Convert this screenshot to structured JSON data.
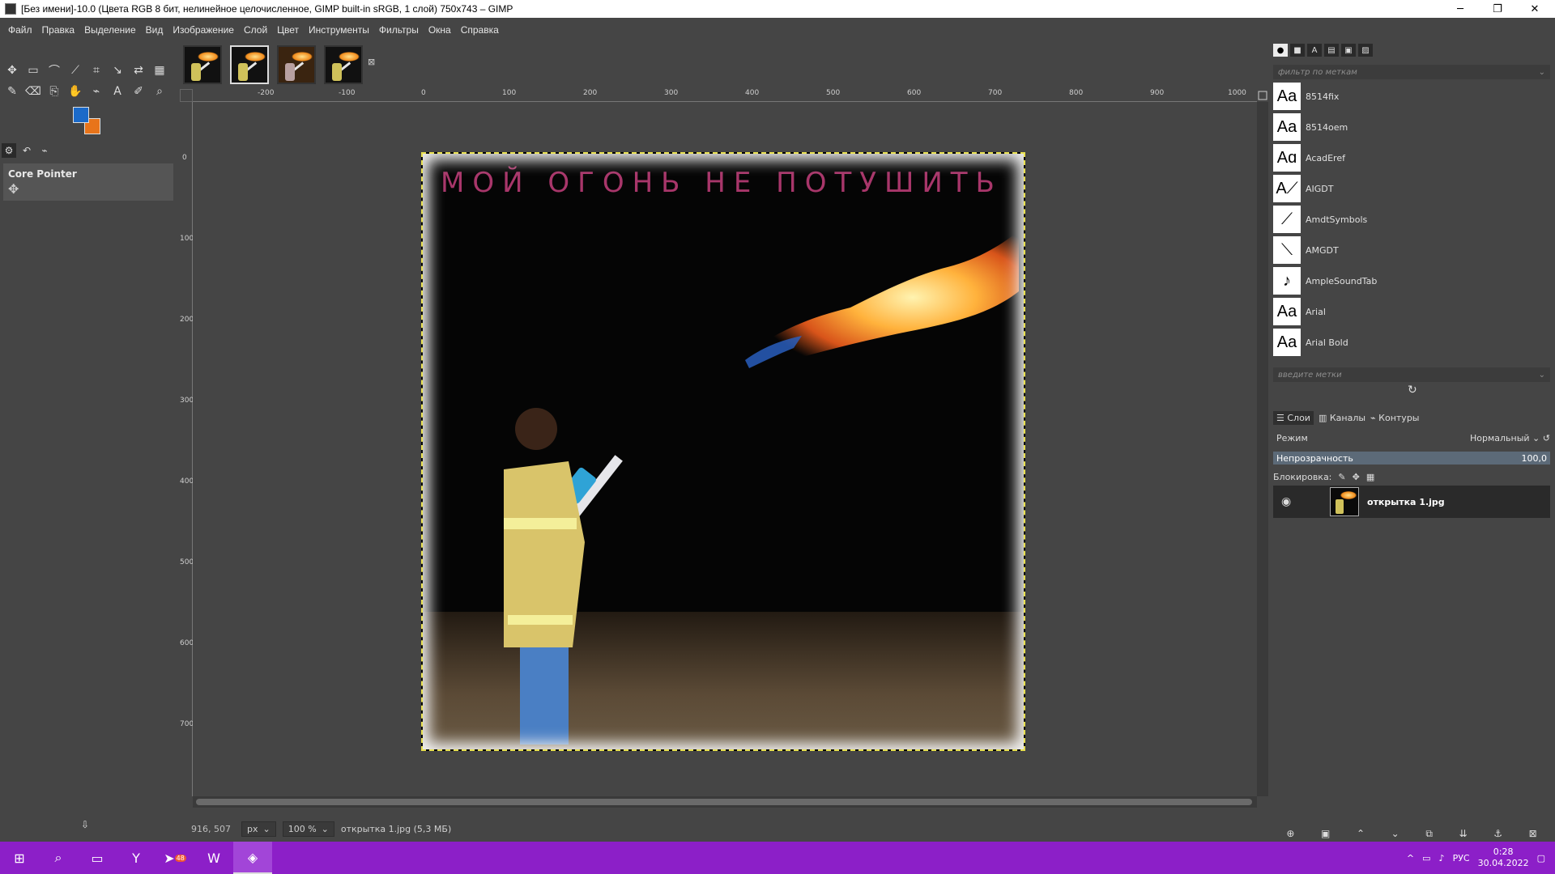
{
  "window": {
    "title": "[Без имени]-10.0 (Цвета RGB 8 бит, нелинейное целочисленное, GIMP built-in sRGB, 1 слой) 750x743 – GIMP",
    "minimize": "─",
    "maximize": "❐",
    "close": "✕"
  },
  "menu": [
    "Файл",
    "Правка",
    "Выделение",
    "Вид",
    "Изображение",
    "Слой",
    "Цвет",
    "Инструменты",
    "Фильтры",
    "Окна",
    "Справка"
  ],
  "toolbox": {
    "tools": [
      "move-icon",
      "rect-select-icon",
      "lasso-icon",
      "fuzzy-select-icon",
      "crop-icon",
      "transform-icon",
      "warp-icon",
      "gradient-icon",
      "paintbrush-icon",
      "eraser-icon",
      "clone-icon",
      "smudge-icon",
      "path-icon",
      "text-icon",
      "color-picker-icon",
      "zoom-icon"
    ],
    "tool_glyphs": [
      "✥",
      "▭",
      "⌒",
      "⟋",
      "⌗",
      "↘",
      "⇄",
      "▦",
      "✎",
      "⌫",
      "⎘",
      "✋",
      "⌁",
      "A",
      "✐",
      "⌕"
    ],
    "fg_color": "#1b6ac9",
    "bg_color": "#e8741a",
    "options_title": "Core Pointer"
  },
  "image_tabs": {
    "count": 4,
    "selected_index": 1
  },
  "rulers": {
    "h_labels": [
      "-200",
      "-100",
      "0",
      "100",
      "200",
      "300",
      "400",
      "500",
      "600",
      "700",
      "800",
      "900",
      "1000"
    ],
    "v_labels": [
      "0",
      "100",
      "200",
      "300",
      "400",
      "500",
      "600",
      "700"
    ]
  },
  "canvas": {
    "caption": "МОЙ ОГОНЬ НЕ ПОТУШИТЬ"
  },
  "statusbar": {
    "coords": "916, 507",
    "unit": "px",
    "zoom": "100 %",
    "file_info": "открытка 1.jpg (5,3 МБ)"
  },
  "fonts_panel": {
    "filter_placeholder": "фильтр по меткам",
    "tags_placeholder": "введите метки",
    "items": [
      {
        "preview": "Aa",
        "name": "8514fix"
      },
      {
        "preview": "Aa",
        "name": "8514oem"
      },
      {
        "preview": "Aɑ",
        "name": "AcadEref"
      },
      {
        "preview": "A⟋",
        "name": "AIGDT"
      },
      {
        "preview": "⟋",
        "name": "AmdtSymbols"
      },
      {
        "preview": "⟍",
        "name": "AMGDT"
      },
      {
        "preview": "♪",
        "name": "AmpleSoundTab"
      },
      {
        "preview": "Aa",
        "name": "Arial"
      },
      {
        "preview": "Aa",
        "name": "Arial Bold"
      }
    ]
  },
  "layers_panel": {
    "tabs": [
      "Слои",
      "Каналы",
      "Контуры"
    ],
    "mode_label": "Режим",
    "mode_value": "Нормальный",
    "opacity_label": "Непрозрачность",
    "opacity_value": "100,0",
    "lock_label": "Блокировка:",
    "layer_name": "открытка 1.jpg"
  },
  "taskbar": {
    "language": "РУС",
    "time": "0:28",
    "date": "30.04.2022",
    "telegram_badge": "48"
  }
}
